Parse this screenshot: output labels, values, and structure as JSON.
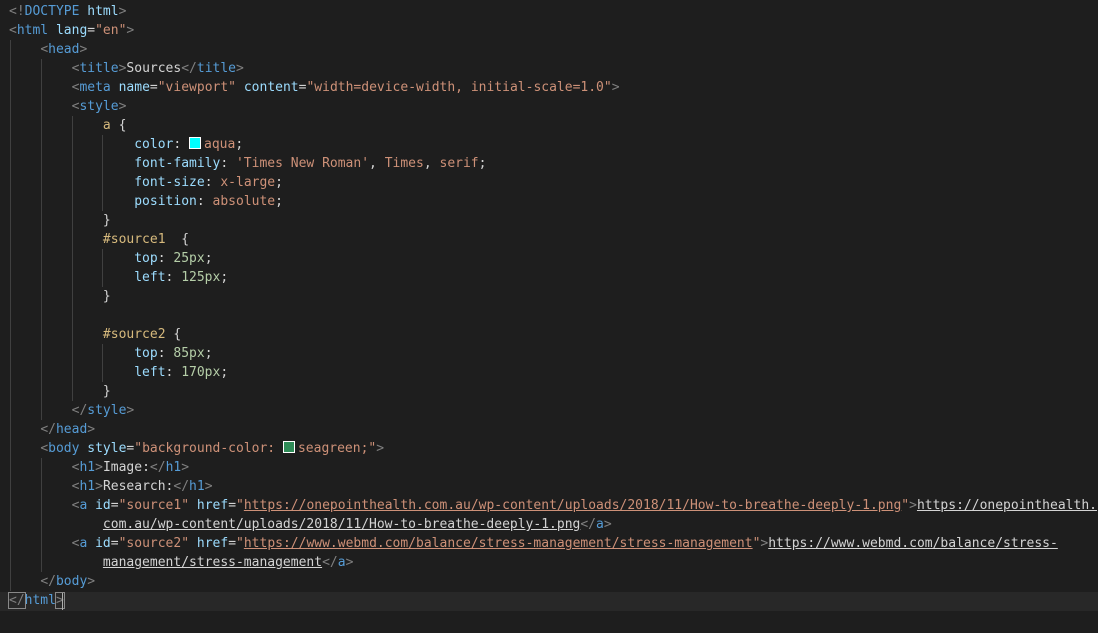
{
  "colors": {
    "background": "#1e1e1e",
    "tag": "#569cd6",
    "punct": "#808080",
    "attr": "#9cdcfe",
    "string": "#ce9178",
    "text": "#d4d4d4",
    "selector": "#d7ba7d",
    "number": "#b5cea8",
    "aqua_swatch": "#00ffff",
    "seagreen_swatch": "#2e8b57"
  },
  "lines": [
    [
      [
        "punct",
        "<!"
      ],
      [
        "tag",
        "DOCTYPE"
      ],
      [
        "text",
        " "
      ],
      [
        "attr",
        "html"
      ],
      [
        "punct",
        ">"
      ]
    ],
    [
      [
        "punct",
        "<"
      ],
      [
        "tag",
        "html"
      ],
      [
        "text",
        " "
      ],
      [
        "attr",
        "lang"
      ],
      [
        "text",
        "="
      ],
      [
        "str",
        "\"en\""
      ],
      [
        "punct",
        ">"
      ]
    ],
    [
      [
        "text",
        "    "
      ],
      [
        "punct",
        "<"
      ],
      [
        "tag",
        "head"
      ],
      [
        "punct",
        ">"
      ]
    ],
    [
      [
        "text",
        "        "
      ],
      [
        "punct",
        "<"
      ],
      [
        "tag",
        "title"
      ],
      [
        "punct",
        ">"
      ],
      [
        "text",
        "Sources"
      ],
      [
        "punct",
        "</"
      ],
      [
        "tag",
        "title"
      ],
      [
        "punct",
        ">"
      ]
    ],
    [
      [
        "text",
        "        "
      ],
      [
        "punct",
        "<"
      ],
      [
        "tag",
        "meta"
      ],
      [
        "text",
        " "
      ],
      [
        "attr",
        "name"
      ],
      [
        "text",
        "="
      ],
      [
        "str",
        "\"viewport\""
      ],
      [
        "text",
        " "
      ],
      [
        "attr",
        "content"
      ],
      [
        "text",
        "="
      ],
      [
        "str",
        "\"width=device-width, initial-scale=1.0\""
      ],
      [
        "punct",
        ">"
      ]
    ],
    [
      [
        "text",
        "        "
      ],
      [
        "punct",
        "<"
      ],
      [
        "tag",
        "style"
      ],
      [
        "punct",
        ">"
      ]
    ],
    [
      [
        "text",
        "            "
      ],
      [
        "sel",
        "a"
      ],
      [
        "text",
        " {"
      ]
    ],
    [
      [
        "text",
        "                "
      ],
      [
        "prop",
        "color"
      ],
      [
        "text",
        ": "
      ],
      [
        "swatch",
        "aqua_swatch"
      ],
      [
        "val",
        "aqua"
      ],
      [
        "text",
        ";"
      ]
    ],
    [
      [
        "text",
        "                "
      ],
      [
        "prop",
        "font-family"
      ],
      [
        "text",
        ": "
      ],
      [
        "val",
        "'Times New Roman'"
      ],
      [
        "text",
        ", "
      ],
      [
        "val",
        "Times"
      ],
      [
        "text",
        ", "
      ],
      [
        "val",
        "serif"
      ],
      [
        "text",
        ";"
      ]
    ],
    [
      [
        "text",
        "                "
      ],
      [
        "prop",
        "font-size"
      ],
      [
        "text",
        ": "
      ],
      [
        "val",
        "x-large"
      ],
      [
        "text",
        ";"
      ]
    ],
    [
      [
        "text",
        "                "
      ],
      [
        "prop",
        "position"
      ],
      [
        "text",
        ": "
      ],
      [
        "val",
        "absolute"
      ],
      [
        "text",
        ";"
      ]
    ],
    [
      [
        "text",
        "            }"
      ]
    ],
    [
      [
        "text",
        "            "
      ],
      [
        "sel",
        "#source1"
      ],
      [
        "text",
        "  {"
      ]
    ],
    [
      [
        "text",
        "                "
      ],
      [
        "prop",
        "top"
      ],
      [
        "text",
        ": "
      ],
      [
        "num",
        "25px"
      ],
      [
        "text",
        ";"
      ]
    ],
    [
      [
        "text",
        "                "
      ],
      [
        "prop",
        "left"
      ],
      [
        "text",
        ": "
      ],
      [
        "num",
        "125px"
      ],
      [
        "text",
        ";"
      ]
    ],
    [
      [
        "text",
        "            }"
      ]
    ],
    [],
    [
      [
        "text",
        "            "
      ],
      [
        "sel",
        "#source2"
      ],
      [
        "text",
        " {"
      ]
    ],
    [
      [
        "text",
        "                "
      ],
      [
        "prop",
        "top"
      ],
      [
        "text",
        ": "
      ],
      [
        "num",
        "85px"
      ],
      [
        "text",
        ";"
      ]
    ],
    [
      [
        "text",
        "                "
      ],
      [
        "prop",
        "left"
      ],
      [
        "text",
        ": "
      ],
      [
        "num",
        "170px"
      ],
      [
        "text",
        ";"
      ]
    ],
    [
      [
        "text",
        "            }"
      ]
    ],
    [
      [
        "text",
        "        "
      ],
      [
        "punct",
        "</"
      ],
      [
        "tag",
        "style"
      ],
      [
        "punct",
        ">"
      ]
    ],
    [
      [
        "text",
        "    "
      ],
      [
        "punct",
        "</"
      ],
      [
        "tag",
        "head"
      ],
      [
        "punct",
        ">"
      ]
    ],
    [
      [
        "text",
        "    "
      ],
      [
        "punct",
        "<"
      ],
      [
        "tag",
        "body"
      ],
      [
        "text",
        " "
      ],
      [
        "attr",
        "style"
      ],
      [
        "text",
        "="
      ],
      [
        "str",
        "\"background-color: "
      ],
      [
        "swatch",
        "seagreen_swatch"
      ],
      [
        "str",
        "seagreen;\""
      ],
      [
        "punct",
        ">"
      ]
    ],
    [
      [
        "text",
        "        "
      ],
      [
        "punct",
        "<"
      ],
      [
        "tag",
        "h1"
      ],
      [
        "punct",
        ">"
      ],
      [
        "text",
        "Image:"
      ],
      [
        "punct",
        "</"
      ],
      [
        "tag",
        "h1"
      ],
      [
        "punct",
        ">"
      ]
    ],
    [
      [
        "text",
        "        "
      ],
      [
        "punct",
        "<"
      ],
      [
        "tag",
        "h1"
      ],
      [
        "punct",
        ">"
      ],
      [
        "text",
        "Research:"
      ],
      [
        "punct",
        "</"
      ],
      [
        "tag",
        "h1"
      ],
      [
        "punct",
        ">"
      ]
    ],
    [
      [
        "text",
        "        "
      ],
      [
        "punct",
        "<"
      ],
      [
        "tag",
        "a"
      ],
      [
        "text",
        " "
      ],
      [
        "attr",
        "id"
      ],
      [
        "text",
        "="
      ],
      [
        "str",
        "\"source1\""
      ],
      [
        "text",
        " "
      ],
      [
        "attr",
        "href"
      ],
      [
        "text",
        "="
      ],
      [
        "str",
        "\""
      ],
      [
        "strlink",
        "https://onepointhealth.com.au/wp-content/uploads/2018/11/How-to-breathe-deeply-1.png"
      ],
      [
        "str",
        "\""
      ],
      [
        "punct",
        ">"
      ],
      [
        "link",
        "https://onepointhealth."
      ]
    ],
    [
      [
        "text",
        "            "
      ],
      [
        "link",
        "com.au/wp-content/uploads/2018/11/How-to-breathe-deeply-1.png"
      ],
      [
        "punct",
        "</"
      ],
      [
        "tag",
        "a"
      ],
      [
        "punct",
        ">"
      ]
    ],
    [
      [
        "text",
        "        "
      ],
      [
        "punct",
        "<"
      ],
      [
        "tag",
        "a"
      ],
      [
        "text",
        " "
      ],
      [
        "attr",
        "id"
      ],
      [
        "text",
        "="
      ],
      [
        "str",
        "\"source2\""
      ],
      [
        "text",
        " "
      ],
      [
        "attr",
        "href"
      ],
      [
        "text",
        "="
      ],
      [
        "str",
        "\""
      ],
      [
        "strlink",
        "https://www.webmd.com/balance/stress-management/stress-management"
      ],
      [
        "str",
        "\""
      ],
      [
        "punct",
        ">"
      ],
      [
        "link",
        "https://www.webmd.com/balance/stress-"
      ]
    ],
    [
      [
        "text",
        "            "
      ],
      [
        "link",
        "management/stress-management"
      ],
      [
        "punct",
        "</"
      ],
      [
        "tag",
        "a"
      ],
      [
        "punct",
        ">"
      ]
    ],
    [
      [
        "text",
        "    "
      ],
      [
        "punct",
        "</"
      ],
      [
        "tag",
        "body"
      ],
      [
        "punct",
        ">"
      ]
    ],
    [
      [
        "punct",
        "</"
      ],
      [
        "tag",
        "html"
      ],
      [
        "punct",
        ">"
      ]
    ]
  ]
}
